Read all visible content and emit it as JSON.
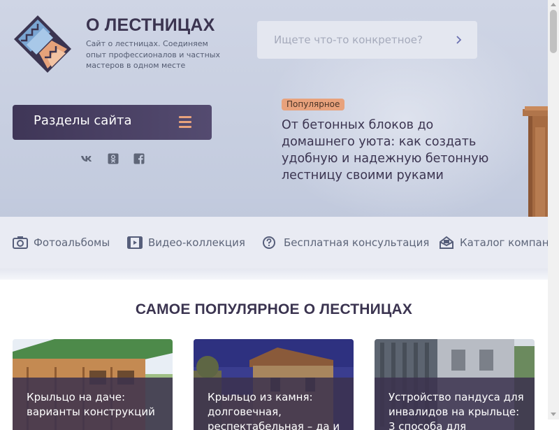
{
  "header": {
    "site_title": "О ЛЕСТНИЦАХ",
    "site_description": "Сайт о лестницах. Соединяем опыт профессионалов и частных мастеров в одном месте",
    "search_placeholder": "Ищете что-то конкретное?",
    "sections_button_label": "Разделы сайта",
    "social_icons": [
      "vk-icon",
      "odnoklassniki-icon",
      "facebook-icon"
    ]
  },
  "featured": {
    "badge": "Популярное",
    "title": "От бетонных блоков до домашнего уюта: как создать удобную и надежную бетонную лестницу своими руками"
  },
  "nav": {
    "items": [
      {
        "label": "Фотоальбомы",
        "icon": "camera-icon"
      },
      {
        "label": "Видео-коллекция",
        "icon": "film-icon"
      },
      {
        "label": "Бесплатная консультация",
        "icon": "question-circle-icon"
      },
      {
        "label": "Каталог компаний",
        "icon": "catalog-icon"
      }
    ]
  },
  "popular": {
    "title": "САМОЕ ПОПУЛЯРНОЕ О ЛЕСТНИЦАХ",
    "cards": [
      {
        "title": "Крыльцо на даче: варианты конструкций"
      },
      {
        "title": "Крыльцо из камня: долговечная, респектабельная – да и"
      },
      {
        "title": "Устройство пандуса для инвалидов на крыльце: 3 способа для"
      }
    ]
  },
  "colors": {
    "brand_dark": "#3f3657",
    "accent_orange": "#e8a27c",
    "hero_bg": "#c7cee0",
    "text_dark": "#3b3450",
    "nav_text": "#5d6579"
  }
}
